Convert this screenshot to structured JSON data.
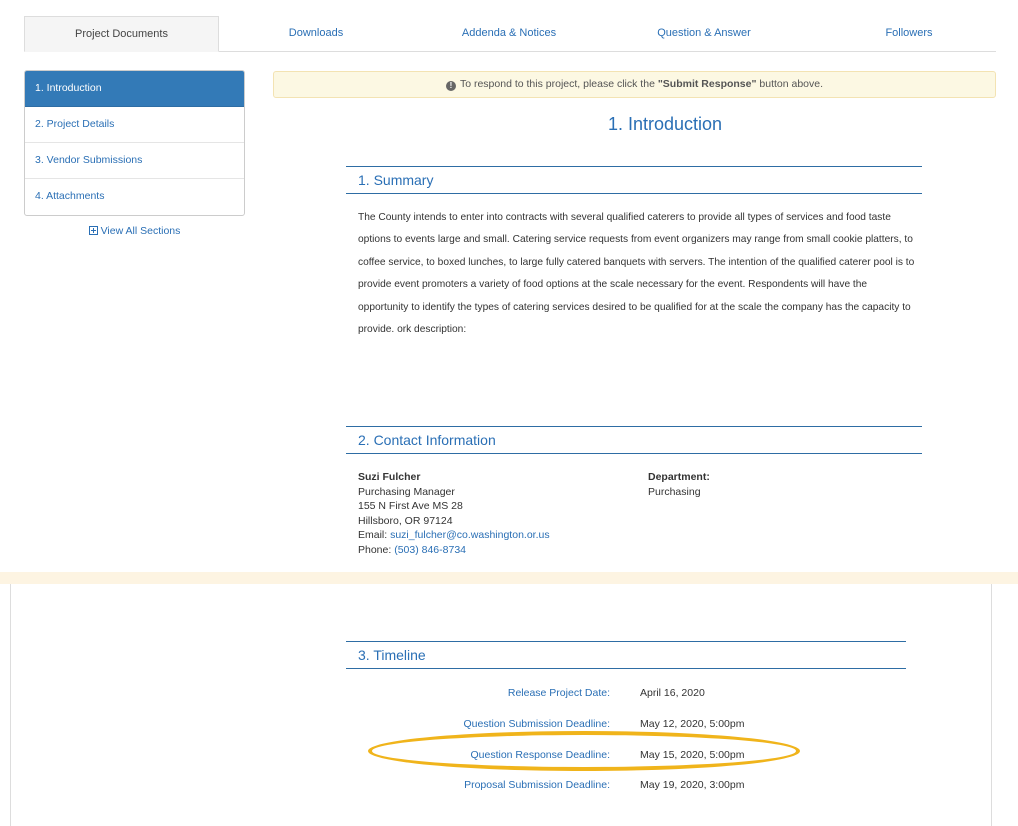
{
  "tabs": [
    {
      "label": "Project Documents",
      "active": true
    },
    {
      "label": "Downloads",
      "active": false
    },
    {
      "label": "Addenda & Notices",
      "active": false
    },
    {
      "label": "Question & Answer",
      "active": false
    },
    {
      "label": "Followers",
      "active": false
    }
  ],
  "sidebar": {
    "items": [
      {
        "label": "1. Introduction",
        "active": true
      },
      {
        "label": "2. Project Details",
        "active": false
      },
      {
        "label": "3. Vendor Submissions",
        "active": false
      },
      {
        "label": "4. Attachments",
        "active": false
      }
    ],
    "view_all": "View All Sections"
  },
  "notice": {
    "prefix": "To respond to this project, please click the ",
    "button_name": "\"Submit Response\"",
    "suffix": " button above."
  },
  "page_title": "1. Introduction",
  "summary": {
    "heading": "1. Summary",
    "body": "The County intends to enter into contracts with several qualified caterers to provide all types of services and food taste options to events large and small. Catering service requests from event organizers may range from small cookie platters, to coffee service, to boxed lunches, to large fully catered banquets with servers. The intention of the qualified caterer pool is to provide event promoters a variety of food options at the scale necessary for the event. Respondents will have the opportunity to identify the types of catering services desired to be qualified for at the scale the company has the capacity to provide.  ork description:"
  },
  "contact": {
    "heading": "2. Contact Information",
    "name": "Suzi Fulcher",
    "title": "Purchasing Manager",
    "address1": "155 N First Ave MS 28",
    "address2": "Hillsboro, OR 97124",
    "email_label": "Email: ",
    "email": "suzi_fulcher@co.washington.or.us",
    "phone_label": "Phone: ",
    "phone": "(503) 846-8734",
    "dept_label": "Department:",
    "dept": "Purchasing"
  },
  "timeline": {
    "heading": "3. Timeline",
    "rows": [
      {
        "label": "Release Project Date:",
        "value": "April 16, 2020"
      },
      {
        "label": "Question Submission Deadline:",
        "value": "May 12, 2020, 5:00pm"
      },
      {
        "label": "Question Response Deadline:",
        "value": "May 15, 2020, 5:00pm"
      },
      {
        "label": "Proposal Submission Deadline:",
        "value": "May 19, 2020, 3:00pm"
      }
    ]
  },
  "colors": {
    "accent": "#337ab7",
    "link": "#2a6fb5",
    "notice_bg": "#fcf8e3",
    "highlight": "#f0b41b"
  }
}
